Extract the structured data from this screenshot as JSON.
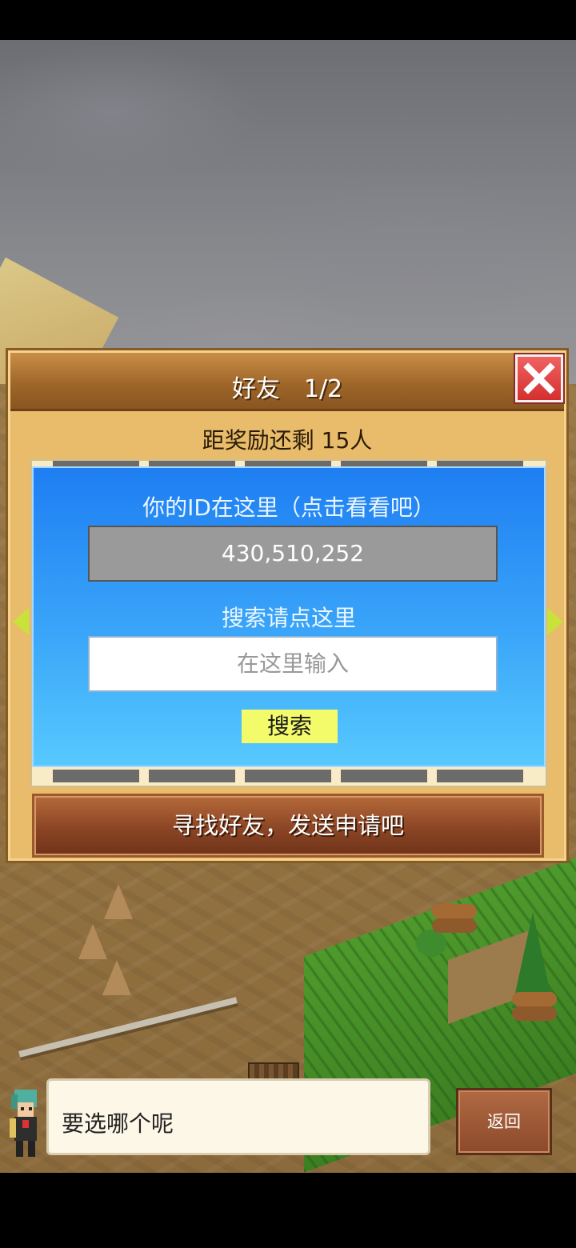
{
  "dialog": {
    "title": "好友　1/2",
    "reward_text": "距奖励还剩 15人",
    "id_label": "你的ID在这里（点击看看吧）",
    "player_id": "430,510,252",
    "search_label": "搜索请点这里",
    "search_placeholder": "在这里输入",
    "search_button": "搜索",
    "find_friends_button": "寻找好友，发送申请吧"
  },
  "footer": {
    "message": "要选哪个呢",
    "back_button": "返回"
  },
  "colors": {
    "panel_blue": "#3aa5f9",
    "search_button": "#f4fb6a",
    "close_red": "#e04444",
    "header_brown": "#9c6428"
  },
  "icons": [
    "close-icon",
    "arrow-left-icon",
    "arrow-right-icon"
  ]
}
